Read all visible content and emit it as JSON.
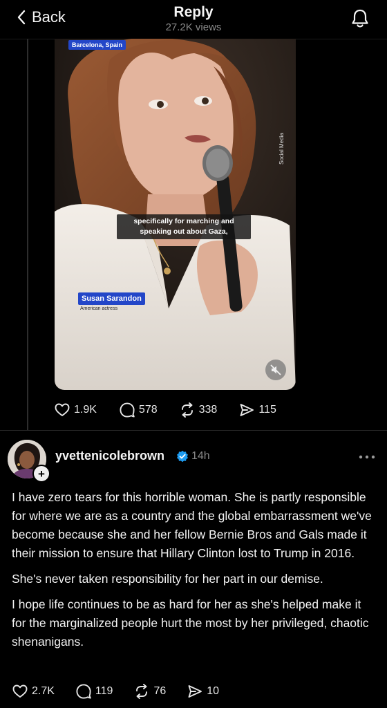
{
  "header": {
    "back_label": "Back",
    "title": "Reply",
    "views": "27.2K views"
  },
  "video": {
    "location_tag": "Barcelona, Spain",
    "side_credit": "Social Media",
    "caption": "specifically for marching and speaking out about Gaza,",
    "name_tag": "Susan Sarandon",
    "name_subtitle": "American actress"
  },
  "parent_actions": {
    "likes": "1.9K",
    "comments": "578",
    "reposts": "338",
    "shares": "115"
  },
  "reply": {
    "username": "yvettenicolebrown",
    "time": "14h",
    "paragraphs": [
      "I have zero tears for this horrible woman. She is partly responsible for where we are as a country and the global embarrassment we've become because she and her fellow Bernie Bros and Gals made it their mission to ensure that Hillary Clinton lost to Trump in 2016.",
      "She's never taken responsibility for her part in our demise.",
      "I hope life continues to be as hard for her as she's helped make it for the marginalized people hurt the most by her privileged, chaotic shenanigans."
    ],
    "likes": "2.7K",
    "comments": "119",
    "reposts": "76",
    "shares": "10"
  },
  "colors": {
    "background": "#000000",
    "verified_badge": "#1d9bf0",
    "news_tag": "#2346c8"
  }
}
